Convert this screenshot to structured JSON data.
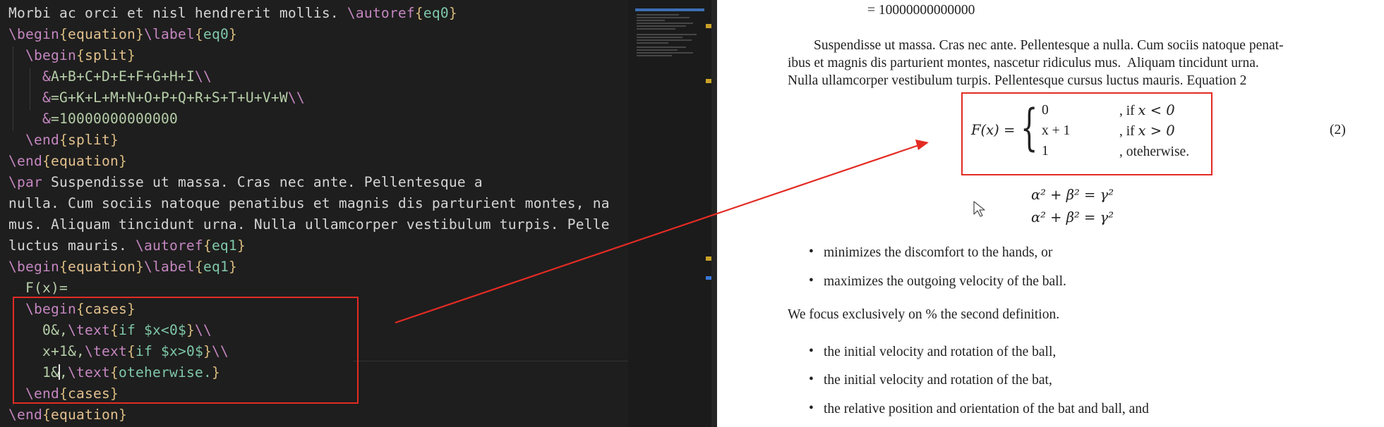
{
  "editor": {
    "lines": [
      {
        "parts": [
          [
            "text",
            "Morbi ac orci et nisl hendrerit mollis. "
          ],
          [
            "cmd",
            "\\autoref"
          ],
          [
            "brace",
            "{"
          ],
          [
            "arg",
            "eq0"
          ],
          [
            "brace",
            "}"
          ]
        ]
      },
      {
        "parts": [
          [
            "cmd",
            "\\begin"
          ],
          [
            "brace",
            "{"
          ],
          [
            "env",
            "equation"
          ],
          [
            "brace",
            "}"
          ],
          [
            "cmd",
            "\\label"
          ],
          [
            "brace",
            "{"
          ],
          [
            "arg",
            "eq0"
          ],
          [
            "brace",
            "}"
          ]
        ]
      },
      {
        "parts": [
          [
            "text",
            "  "
          ],
          [
            "cmd",
            "\\begin"
          ],
          [
            "brace",
            "{"
          ],
          [
            "env",
            "split"
          ],
          [
            "brace",
            "}"
          ]
        ]
      },
      {
        "parts": [
          [
            "text",
            "    "
          ],
          [
            "cmd",
            "&"
          ],
          [
            "math",
            "A+B+C+D+E+F+G+H+I"
          ],
          [
            "cmd",
            "\\\\"
          ]
        ]
      },
      {
        "parts": [
          [
            "text",
            "    "
          ],
          [
            "cmd",
            "&"
          ],
          [
            "math",
            "=G+K+L+M+N+O+P+Q+R+S+T+U+V+W"
          ],
          [
            "cmd",
            "\\\\"
          ]
        ]
      },
      {
        "parts": [
          [
            "text",
            "    "
          ],
          [
            "cmd",
            "&"
          ],
          [
            "math",
            "=10000000000000"
          ]
        ]
      },
      {
        "parts": [
          [
            "text",
            "  "
          ],
          [
            "cmd",
            "\\end"
          ],
          [
            "brace",
            "{"
          ],
          [
            "env",
            "split"
          ],
          [
            "brace",
            "}"
          ]
        ]
      },
      {
        "parts": [
          [
            "cmd",
            "\\end"
          ],
          [
            "brace",
            "{"
          ],
          [
            "env",
            "equation"
          ],
          [
            "brace",
            "}"
          ]
        ]
      },
      {
        "parts": [
          [
            "cmd",
            "\\par"
          ],
          [
            "text",
            " Suspendisse ut massa. Cras nec ante. Pellentesque a"
          ]
        ]
      },
      {
        "parts": [
          [
            "text",
            "nulla. Cum sociis natoque penatibus et magnis dis parturient montes, na"
          ]
        ]
      },
      {
        "parts": [
          [
            "text",
            "mus. Aliquam tincidunt urna. Nulla ullamcorper vestibulum turpis. Pelle"
          ]
        ]
      },
      {
        "parts": [
          [
            "text",
            "luctus mauris. "
          ],
          [
            "cmd",
            "\\autoref"
          ],
          [
            "brace",
            "{"
          ],
          [
            "arg",
            "eq1"
          ],
          [
            "brace",
            "}"
          ]
        ]
      },
      {
        "parts": [
          [
            "cmd",
            "\\begin"
          ],
          [
            "brace",
            "{"
          ],
          [
            "env",
            "equation"
          ],
          [
            "brace",
            "}"
          ],
          [
            "cmd",
            "\\label"
          ],
          [
            "brace",
            "{"
          ],
          [
            "arg",
            "eq1"
          ],
          [
            "brace",
            "}"
          ]
        ]
      },
      {
        "parts": [
          [
            "text",
            "  "
          ],
          [
            "math",
            "F(x)="
          ]
        ]
      },
      {
        "parts": [
          [
            "text",
            "  "
          ],
          [
            "cmd",
            "\\begin"
          ],
          [
            "brace",
            "{"
          ],
          [
            "env",
            "cases"
          ],
          [
            "brace",
            "}"
          ]
        ]
      },
      {
        "parts": [
          [
            "text",
            "    "
          ],
          [
            "math",
            "0&,"
          ],
          [
            "cmd",
            "\\text"
          ],
          [
            "brace",
            "{"
          ],
          [
            "arg",
            "if $x<0$"
          ],
          [
            "brace",
            "}"
          ],
          [
            "cmd",
            "\\\\"
          ]
        ]
      },
      {
        "parts": [
          [
            "text",
            "    "
          ],
          [
            "math",
            "x+1&,"
          ],
          [
            "cmd",
            "\\text"
          ],
          [
            "brace",
            "{"
          ],
          [
            "arg",
            "if $x>0$"
          ],
          [
            "brace",
            "}"
          ],
          [
            "cmd",
            "\\\\"
          ]
        ]
      },
      {
        "parts": [
          [
            "text",
            "    "
          ],
          [
            "math",
            "1&"
          ],
          [
            "cursor",
            ""
          ],
          [
            "math",
            ","
          ],
          [
            "cmd",
            "\\text"
          ],
          [
            "brace",
            "{"
          ],
          [
            "arg",
            "oteherwise."
          ],
          [
            "brace",
            "}"
          ]
        ]
      },
      {
        "parts": [
          [
            "text",
            "  "
          ],
          [
            "cmd",
            "\\end"
          ],
          [
            "brace",
            "{"
          ],
          [
            "env",
            "cases"
          ],
          [
            "brace",
            "}"
          ]
        ]
      },
      {
        "parts": [
          [
            "cmd",
            "\\end"
          ],
          [
            "brace",
            "{"
          ],
          [
            "env",
            "equation"
          ],
          [
            "brace",
            "}"
          ]
        ]
      }
    ]
  },
  "pdf": {
    "top_eq": "= 10000000000000",
    "paragraph": [
      "Suspendisse ut massa. Cras nec ante. Pellentesque a nulla. Cum sociis natoque penat-",
      "ibus et magnis dis parturient montes, nascetur ridiculus mus.  Aliquam tincidunt urna.",
      "Nulla ullamcorper vestibulum turpis. Pellentesque cursus luctus mauris. Equation 2"
    ],
    "equation": {
      "lhs": "F(x) =",
      "cases": [
        {
          "value": "0",
          "cond_prefix": ", if ",
          "cond_math": "x < 0"
        },
        {
          "value": "x + 1",
          "cond_prefix": ", if ",
          "cond_math": "x > 0"
        },
        {
          "value": "1",
          "cond_prefix": ", oteherwise.",
          "cond_math": ""
        }
      ],
      "number": "(2)"
    },
    "alpha_lines": [
      "α² + β² = γ²",
      "α² + β² = γ²"
    ],
    "bullets1": [
      "minimizes the discomfort to the hands, or",
      "maximizes the outgoing velocity of the ball."
    ],
    "focus_text": "We focus exclusively on % the second definition.",
    "bullets2": [
      "the initial velocity and rotation of the ball,",
      "the initial velocity and rotation of the bat,",
      "the relative position and orientation of the bat and ball, and"
    ],
    "bullet_char": "•"
  },
  "colors": {
    "highlight": "#e32b24",
    "editor_bg": "#1e1e1e"
  }
}
